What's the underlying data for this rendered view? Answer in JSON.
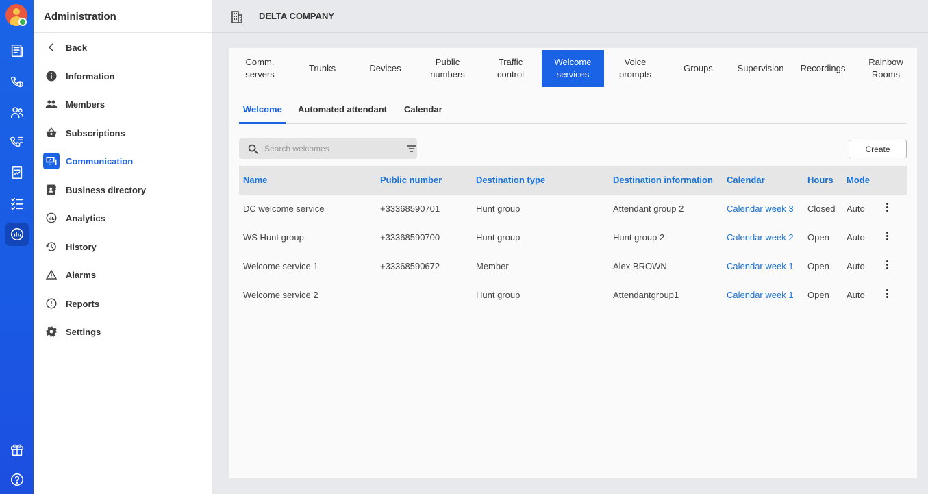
{
  "header": {
    "company": "DELTA COMPANY"
  },
  "sidebar": {
    "title": "Administration",
    "items": [
      {
        "label": "Back",
        "icon": "chevron-left-icon"
      },
      {
        "label": "Information",
        "icon": "info-icon"
      },
      {
        "label": "Members",
        "icon": "people-icon"
      },
      {
        "label": "Subscriptions",
        "icon": "basket-icon"
      },
      {
        "label": "Communication",
        "icon": "communication-icon",
        "active": true
      },
      {
        "label": "Business directory",
        "icon": "directory-icon"
      },
      {
        "label": "Analytics",
        "icon": "analytics-icon"
      },
      {
        "label": "History",
        "icon": "history-icon"
      },
      {
        "label": "Alarms",
        "icon": "warning-icon"
      },
      {
        "label": "Reports",
        "icon": "report-icon"
      },
      {
        "label": "Settings",
        "icon": "gear-icon"
      }
    ]
  },
  "tabs": [
    {
      "label": "Comm.\nservers"
    },
    {
      "label": "Trunks"
    },
    {
      "label": "Devices"
    },
    {
      "label": "Public\nnumbers"
    },
    {
      "label": "Traffic\ncontrol"
    },
    {
      "label": "Welcome\nservices",
      "active": true
    },
    {
      "label": "Voice\nprompts"
    },
    {
      "label": "Groups"
    },
    {
      "label": "Supervision"
    },
    {
      "label": "Recordings"
    },
    {
      "label": "Rainbow\nRooms"
    }
  ],
  "subtabs": [
    {
      "label": "Welcome",
      "active": true
    },
    {
      "label": "Automated attendant"
    },
    {
      "label": "Calendar"
    }
  ],
  "search": {
    "placeholder": "Search welcomes",
    "value": ""
  },
  "create_label": "Create",
  "table": {
    "columns": [
      "Name",
      "Public number",
      "Destination type",
      "Destination information",
      "Calendar",
      "Hours",
      "Mode"
    ],
    "rows": [
      [
        "DC welcome service",
        "+33368590701",
        "Hunt group",
        "Attendant group 2",
        "Calendar week 3",
        "Closed",
        "Auto"
      ],
      [
        "WS Hunt group",
        "+33368590700",
        "Hunt group",
        "Hunt group 2",
        "Calendar week 2",
        "Open",
        "Auto"
      ],
      [
        "Welcome service 1",
        "+33368590672",
        "Member",
        "Alex BROWN",
        "Calendar week 1",
        "Open",
        "Auto"
      ],
      [
        "Welcome service 2",
        "",
        "Hunt group",
        "Attendantgroup1",
        "Calendar week 1",
        "Open",
        "Auto"
      ]
    ]
  },
  "colors": {
    "accent": "#1a63e6",
    "link": "#1a73d6"
  }
}
